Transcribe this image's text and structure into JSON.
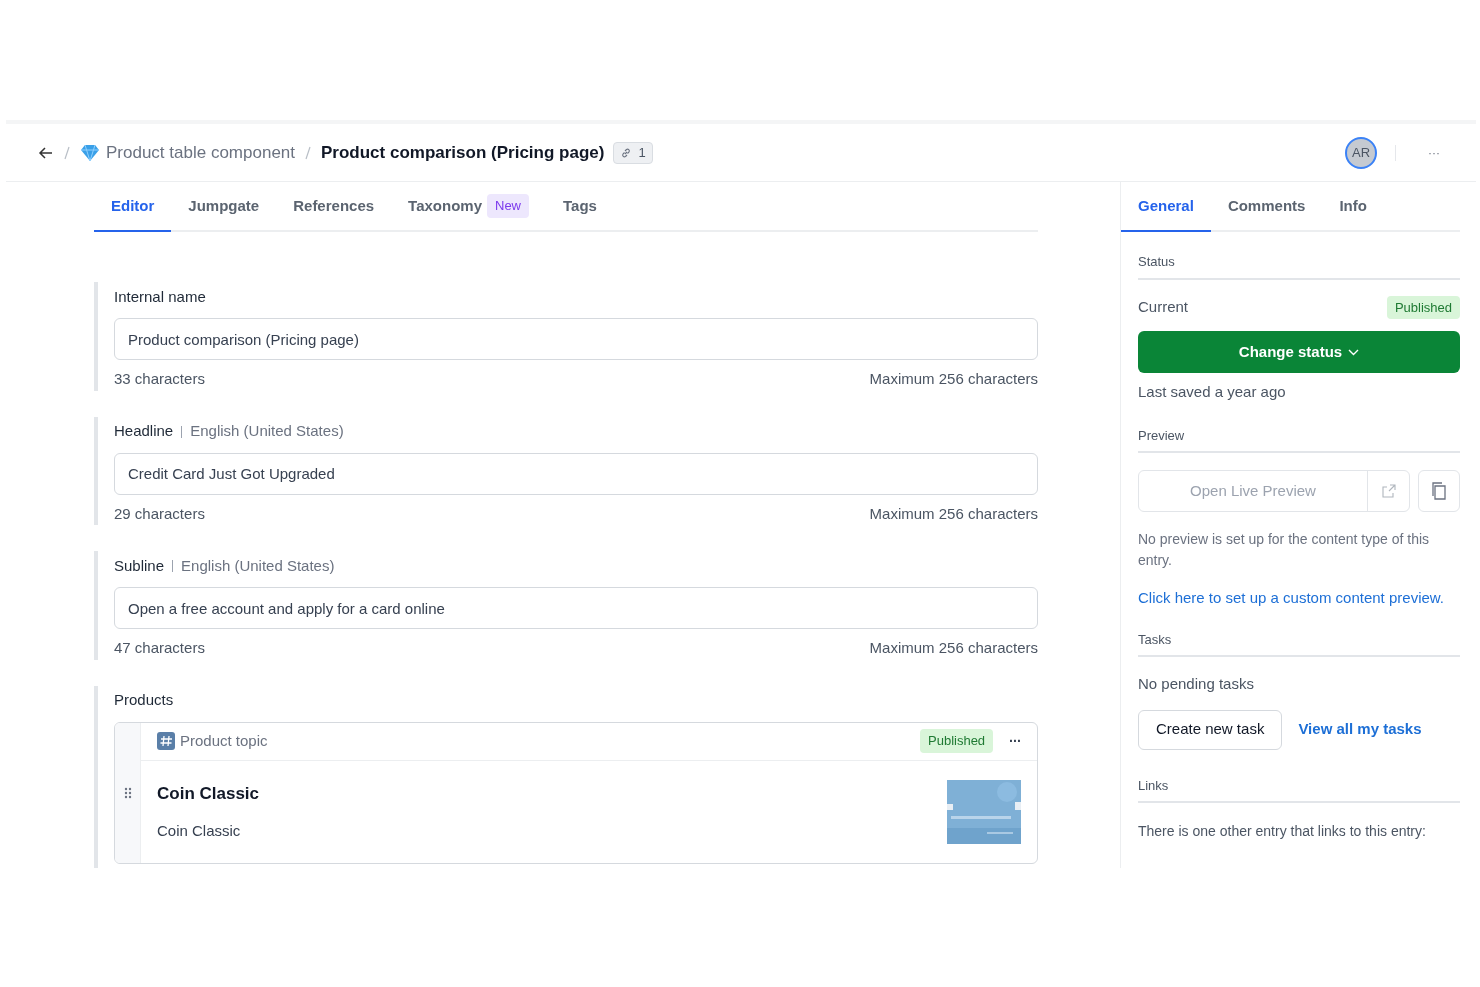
{
  "breadcrumb": {
    "parent": "Product table component",
    "title": "Product comparison (Pricing page)",
    "link_count": "1"
  },
  "header": {
    "avatar": "AR",
    "more": "···"
  },
  "tabs": [
    {
      "label": "Editor",
      "selected": true
    },
    {
      "label": "Jumpgate",
      "selected": false
    },
    {
      "label": "References",
      "selected": false
    },
    {
      "label": "Taxonomy",
      "selected": false,
      "badge": "New"
    },
    {
      "label": "Tags",
      "selected": false
    }
  ],
  "fields": [
    {
      "label": "Internal name",
      "value": "Product comparison (Pricing page)",
      "count": "33 characters",
      "max": "Maximum 256 characters"
    },
    {
      "label": "Headline",
      "locale": "English (United States)",
      "value": "Credit Card Just Got Upgraded",
      "count": "29 characters",
      "max": "Maximum 256 characters"
    },
    {
      "label": "Subline",
      "locale": "English (United States)",
      "value": "Open a free account and apply for a card online",
      "count": "47 characters",
      "max": "Maximum 256 characters"
    }
  ],
  "products": {
    "label": "Products",
    "items": [
      {
        "type": "Product topic",
        "status": "Published",
        "title": "Coin Classic",
        "subtitle": "Coin Classic"
      }
    ]
  },
  "sidebar": {
    "tabs": [
      {
        "label": "General",
        "selected": true
      },
      {
        "label": "Comments",
        "selected": false
      },
      {
        "label": "Info",
        "selected": false
      }
    ],
    "status": {
      "heading": "Status",
      "current_label": "Current",
      "current": "Published",
      "button": "Change status",
      "saved": "Last saved a year ago"
    },
    "preview": {
      "heading": "Preview",
      "button": "Open Live Preview",
      "note": "No preview is set up for the content type of this entry.",
      "link": "Click here to set up a custom content preview."
    },
    "tasks": {
      "heading": "Tasks",
      "empty": "No pending tasks",
      "create": "Create new task",
      "view_all": "View all my tasks"
    },
    "links": {
      "heading": "Links",
      "text": "There is one other entry that links to this entry:"
    }
  }
}
